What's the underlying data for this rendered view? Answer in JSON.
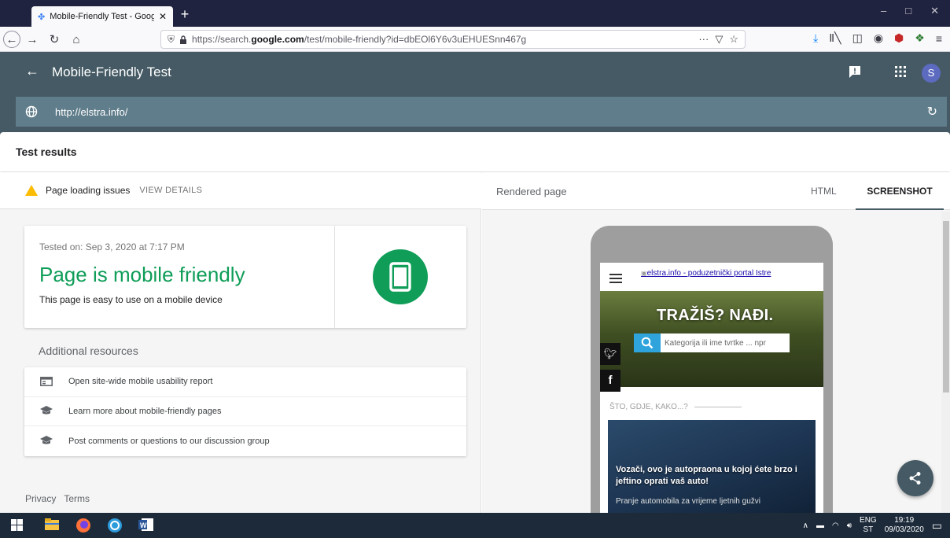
{
  "browser": {
    "tab_title": "Mobile-Friendly Test - Google",
    "url_prefix": "https://search.",
    "url_domain": "google.com",
    "url_path": "/test/mobile-friendly?id=dbEOl6Y6v3uEHUESnn467g",
    "url_more": "···"
  },
  "app": {
    "title": "Mobile-Friendly Test",
    "avatar_letter": "S",
    "tested_url": "http://elstra.info/"
  },
  "results": {
    "heading": "Test results",
    "issues_label": "Page loading issues",
    "view_details": "VIEW DETAILS",
    "tested_on": "Tested on: Sep 3, 2020 at 7:17 PM",
    "verdict": "Page is mobile friendly",
    "verdict_sub": "This page is easy to use on a mobile device",
    "additional_heading": "Additional resources",
    "resources": [
      {
        "label": "Open site-wide mobile usability report"
      },
      {
        "label": "Learn more about mobile-friendly pages"
      },
      {
        "label": "Post comments or questions to our discussion group"
      }
    ],
    "footer": {
      "privacy": "Privacy",
      "terms": "Terms"
    }
  },
  "rendered": {
    "label": "Rendered page",
    "tab_html": "HTML",
    "tab_screenshot": "SCREENSHOT",
    "logo_alt": "elstra.info - poduzetnički portal Istre",
    "hero_title": "TRAŽIŠ? NAĐI.",
    "search_placeholder": "Kategorija ili ime tvrtke ... npr",
    "section": "ŠTO, GDJE, KAKO...?",
    "article_title": "Vozači, ovo je autopraona u kojoj ćete brzo i jeftino oprati vaš auto!",
    "article_sub": "Pranje automobila za vrijeme ljetnih gužvi"
  },
  "taskbar": {
    "lang": "ENG",
    "lang_sub": "ST",
    "time": "19:19",
    "date": "09/03/2020"
  },
  "colors": {
    "header": "#455a64",
    "url_strip": "#607d8b",
    "success": "#0f9d58",
    "warning": "#fbbc04"
  }
}
